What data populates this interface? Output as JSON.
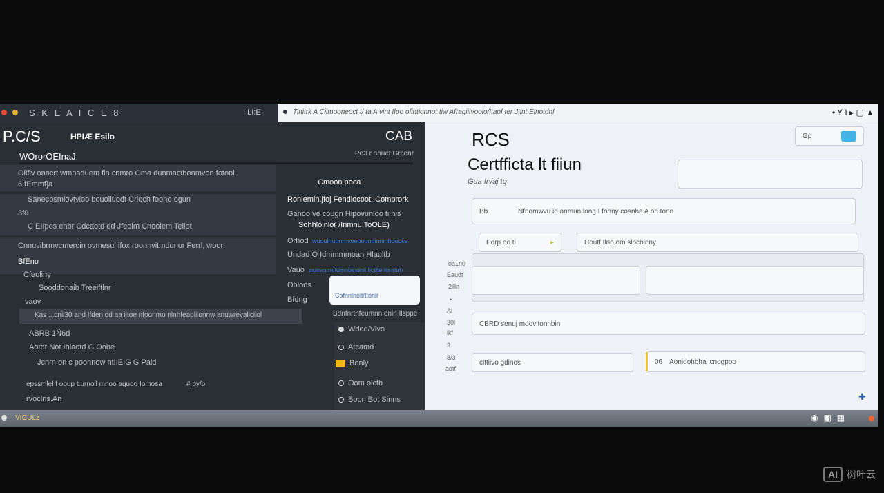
{
  "topbar": {
    "menu": "S K E A I C E 8",
    "status": "I LI:E"
  },
  "address": {
    "text": "Tinitrk A   Ciimooneoct t/ ta A  vint Ifoo  ofintionnot tiw Afragiitvoolo/Itaof ter Jtlnt Elnotdnf",
    "controls": "• Y I   ▸   ▢   ▲"
  },
  "left": {
    "app_title": "P.C/S",
    "app_subtitle": "HPIÆ Esilo",
    "cab": "CAB",
    "cab_sub": "Po3 r  onuet Grconr",
    "section": "WOrorOEInaJ",
    "items": [
      "Olifiv onocrt wmnaduem fin cnmro  Oma dunmacthonmvon fotonl",
      "6  fEmmf]a",
      "Sanecbsmlovtvioo bouoliuodt Crloch foono ogun",
      "3f0",
      "C EIIpos enbr Cdcaotd dd Jfeolm Cnoolem Tellot",
      "Cnnuvibrmvcmeroin ovmesul ifox roonnvitmdunor Ferrl, woor",
      "BfEno",
      "Cfeoliny",
      "Sooddonaib Treeiftlnr",
      "vaov",
      "Kas ...cnii30 and Ifden dd aa iitoe nfoonmo nlnhfeaolilonnw anuwrevalicilol",
      "ABRB 1Ñ6d",
      "Aotor  Not Ihlaotd G Oobe",
      "Jcnrn on c poohnow ntIIEIG G Pald",
      "epssmlel f ooup t.urnoll mnoo  aguoo Iomosa",
      "rvoclns.An"
    ],
    "tag": "# py/o",
    "mid": [
      "Cmoon poca",
      "Ronlemln.jfoj Fendlocoot, Comprork",
      "Ganoo  ve cougn Hipovunloo ti nis",
      "Sohhlolnlor /Inmnu ToOLE)",
      "Orhod",
      "Undad O Idmmmmoan Hlaultb",
      "Vauo",
      "Obloos",
      "Bfdng"
    ],
    "mid_links": [
      "wuoulnudnmvoeboundinninhoocke",
      "nuinmmvfdinnbindnii fictite lonrtoh"
    ],
    "popup": "Cofnnlnolt/Itonlr",
    "popup_sub": "Bdnfnrthfeumnn onin Ilsppe",
    "side": [
      "Wdod/Vivo",
      "Atcamd",
      "Bonly",
      "Oom olctb",
      "Boon Bot Sinns"
    ]
  },
  "right": {
    "logo": "RCS",
    "title": "Certfficta lt fiiun",
    "subtitle": "Gua Irvaj tq",
    "toggle": "Gp",
    "fields": {
      "main": "Nfnomwvu id anmun long I fonny cosnha A ori.tonn",
      "main_label": "Bb",
      "small": "Porp oo ti",
      "wide": "Houtf Ilno  om slocbinny",
      "full": "CBRD  sonuj moovitonnbin",
      "bottom_left": "clttiivo gdinos",
      "bottom_right": "Aonidohbhaj cnogpoo",
      "bottom_right_label": "06"
    },
    "side_labels": [
      "oa1n0",
      "Eaudt",
      "2illn",
      "•",
      "Al",
      "30l",
      "ikf",
      "3",
      "8/3",
      "adtf"
    ]
  },
  "taskbar": {
    "label": "VIGULz"
  },
  "watermark": {
    "text": "树叶云",
    "logo": "AI"
  },
  "colors": {
    "accent": "#3d7be0",
    "panel": "#2a2e35",
    "form": "#eef1f5"
  }
}
